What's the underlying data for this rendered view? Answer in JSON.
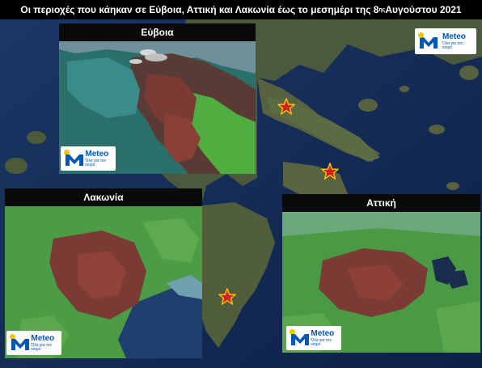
{
  "title": {
    "main": "Οι περιοχές που κάηκαν σε Εύβοια, Αττική και Λακωνία έως το μεσημέρι της 8",
    "superscript": "ης",
    "tail": " Αυγούστου 2021"
  },
  "panels": {
    "evia": {
      "label": "Εύβοια"
    },
    "lakonia": {
      "label": "Λακωνία"
    },
    "attiki": {
      "label": "Αττική"
    }
  },
  "logo": {
    "brand": "Meteo",
    "tagline": "Όλα για τον καιρό"
  },
  "markers": [
    {
      "name": "marker-evia",
      "icon": "star-marker-icon",
      "color": "#f2c200"
    },
    {
      "name": "marker-attiki",
      "icon": "star-marker-icon",
      "color": "#f2c200"
    },
    {
      "name": "marker-lakonia",
      "icon": "star-marker-icon",
      "color": "#f2c200"
    }
  ],
  "colors": {
    "sea": "#13294f",
    "burned": "#7a3b34",
    "vegetation": "#3f8f3a",
    "marker_fill": "#d81f1f"
  }
}
